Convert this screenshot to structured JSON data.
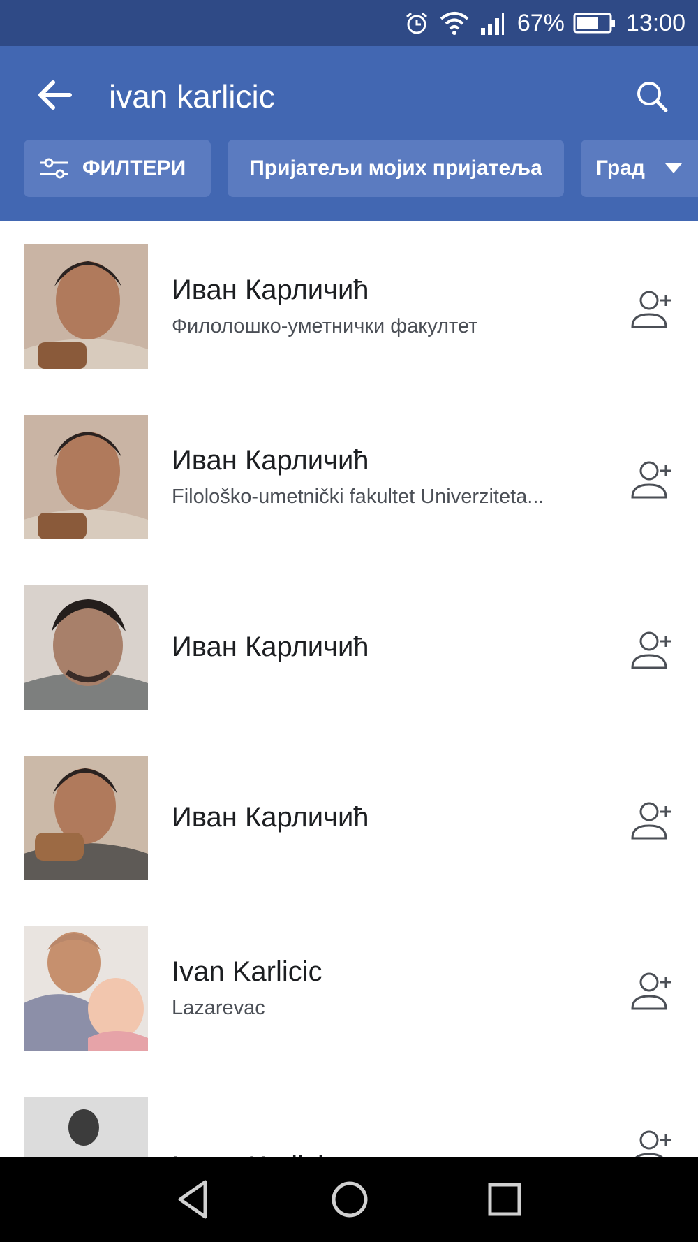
{
  "status_bar": {
    "battery_percent": "67%",
    "time": "13:00",
    "icons": [
      "alarm-icon",
      "wifi-icon",
      "signal-icon",
      "battery-icon"
    ]
  },
  "search": {
    "query": "ivan karlicic",
    "icons": [
      "back-arrow-icon",
      "search-icon"
    ]
  },
  "filters": {
    "filters_label": "ФИЛТЕРИ",
    "friends_of_friends": "Пријатељи мојих пријатеља",
    "city": "Град"
  },
  "results": [
    {
      "name": "Иван Карличић",
      "subtitle": "Филолошко-уметнички факултет"
    },
    {
      "name": "Иван Карличић",
      "subtitle": "Filološko-umetnički fakultet Univerziteta..."
    },
    {
      "name": "Иван Карличић",
      "subtitle": ""
    },
    {
      "name": "Иван Карличић",
      "subtitle": ""
    },
    {
      "name": "Ivan Karlicic",
      "subtitle": "Lazarevac"
    },
    {
      "name": "Ivana Karlicic",
      "subtitle": ""
    }
  ],
  "colors": {
    "status_bar": "#2f4a86",
    "app_bar": "#4267b2",
    "chip": "#5b7bc0",
    "nav_bar": "#000000"
  },
  "nav_bar": {
    "icons": [
      "nav-back-icon",
      "nav-home-icon",
      "nav-recents-icon"
    ]
  }
}
